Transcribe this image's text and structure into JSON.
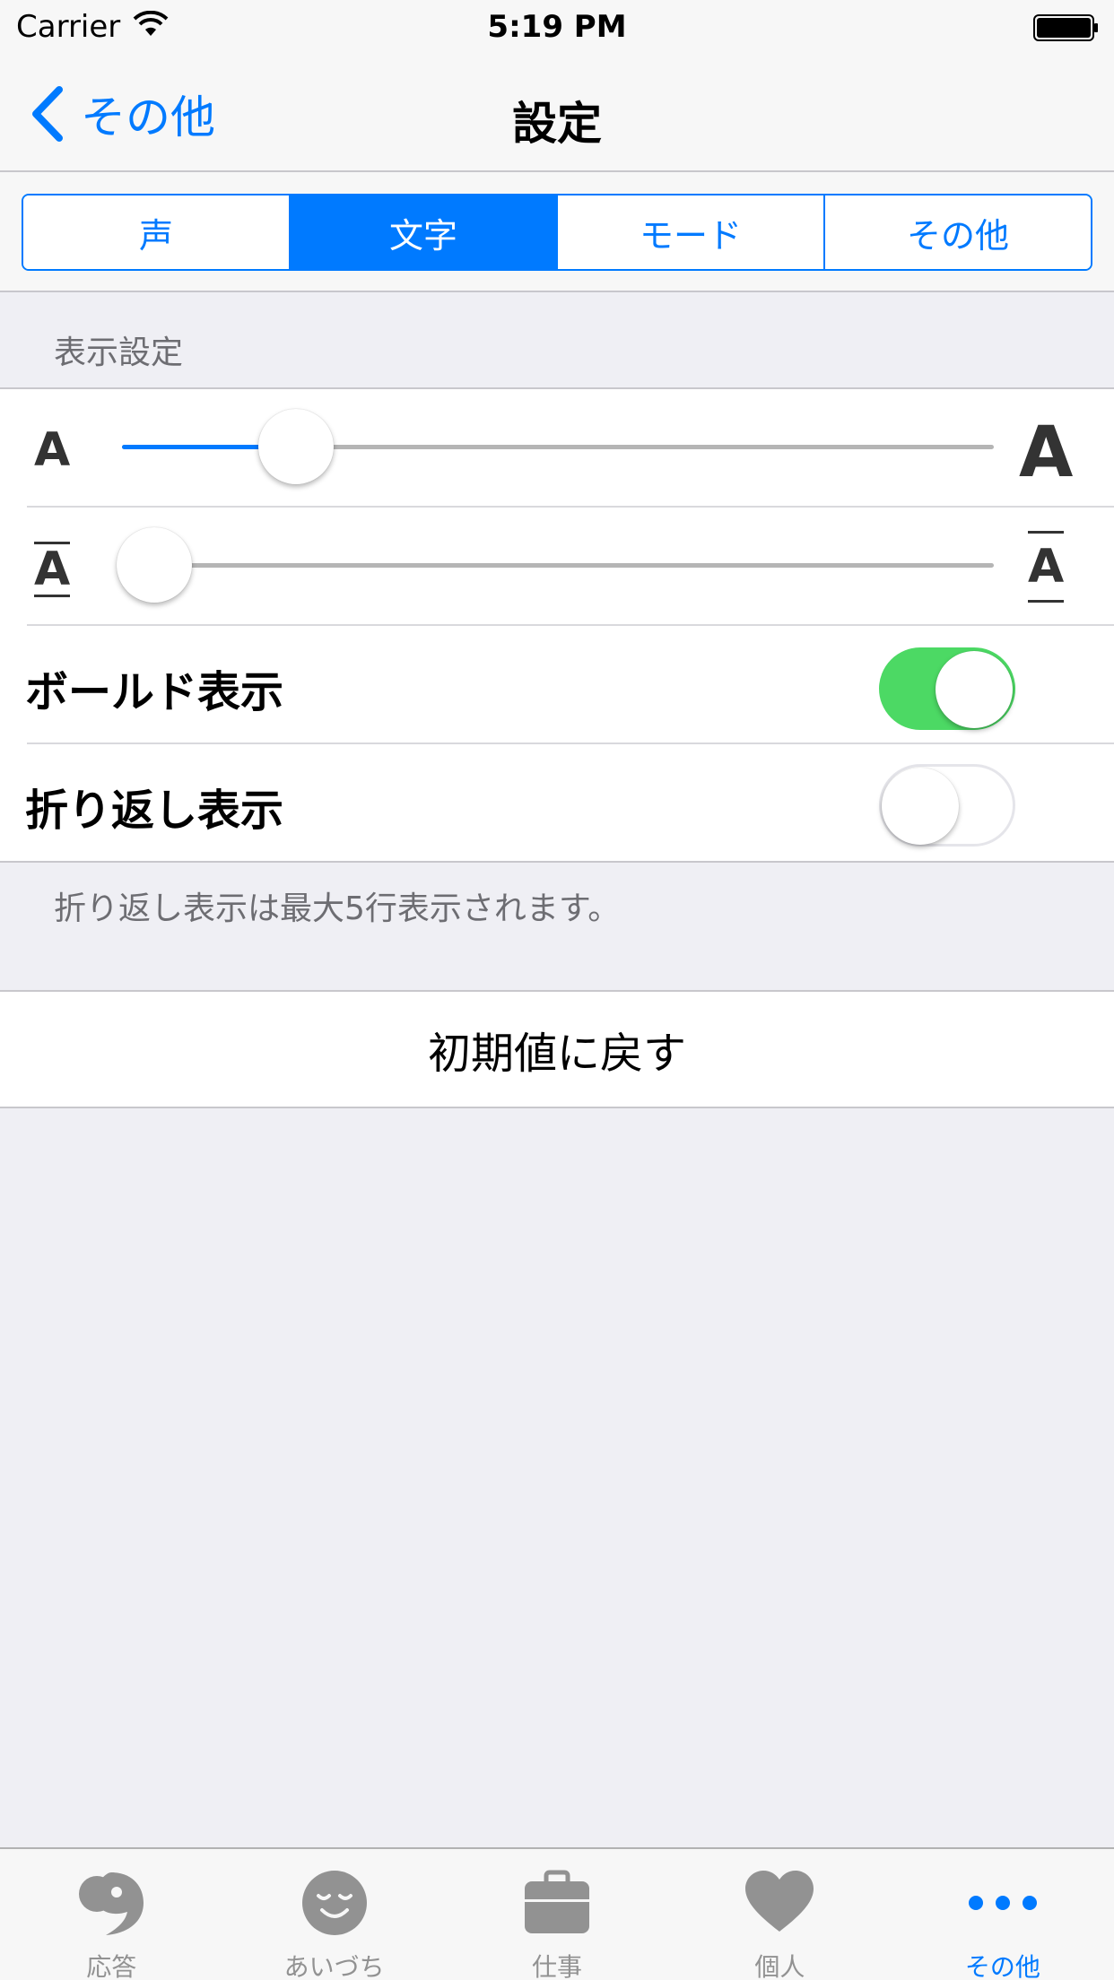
{
  "status_bar": {
    "carrier": "Carrier",
    "time": "5:19 PM"
  },
  "nav": {
    "back_label": "その他",
    "title": "設定"
  },
  "segments": [
    {
      "label": "声",
      "active": false
    },
    {
      "label": "文字",
      "active": true
    },
    {
      "label": "モード",
      "active": false
    },
    {
      "label": "その他",
      "active": false
    }
  ],
  "display_section": {
    "header": "表示設定",
    "font_size_slider": {
      "value": 0.2,
      "min_glyph": "A",
      "max_glyph": "A"
    },
    "line_spacing_slider": {
      "value": 0.0,
      "min_glyph": "A",
      "max_glyph": "A"
    },
    "bold": {
      "label": "ボールド表示",
      "on": true
    },
    "wrap": {
      "label": "折り返し表示",
      "on": false
    },
    "footer": "折り返し表示は最大5行表示されます。"
  },
  "reset": {
    "label": "初期値に戻す"
  },
  "tabs": [
    {
      "label": "応答",
      "icon": "comma-icon",
      "active": false
    },
    {
      "label": "あいづち",
      "icon": "smile-face-icon",
      "active": false
    },
    {
      "label": "仕事",
      "icon": "briefcase-icon",
      "active": false
    },
    {
      "label": "個人",
      "icon": "heart-icon",
      "active": false
    },
    {
      "label": "その他",
      "icon": "more-dots-icon",
      "active": true
    }
  ],
  "colors": {
    "accent": "#007aff",
    "toggle_on": "#4cd964",
    "background": "#efeff4"
  }
}
